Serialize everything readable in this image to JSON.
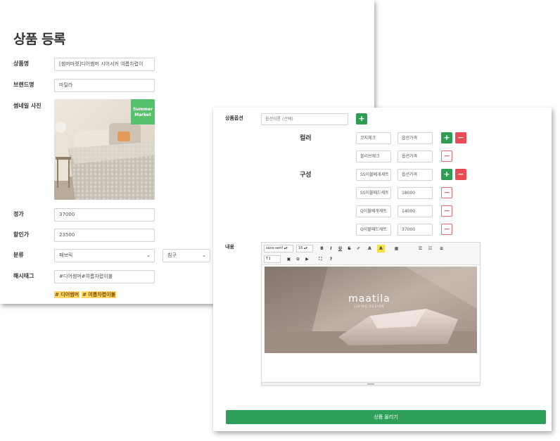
{
  "page": {
    "title": "상품 등록"
  },
  "form": {
    "name_label": "상품명",
    "name_value": "[썸머마켓]디어썸머 시어서커 여름차렵이",
    "brand_label": "브랜드명",
    "brand_value": "마틸라",
    "thumbnail_label": "썸네일 사진",
    "thumbnail_badge_line1": "Summer",
    "thumbnail_badge_line2": "Market",
    "price_label": "정가",
    "price_value": "37000",
    "sale_label": "할인가",
    "sale_value": "23500",
    "category_label": "분류",
    "category_value": "패브릭",
    "subcategory_value": "침구",
    "hashtag_label": "해시태그",
    "hashtag_value": "#디어썸머#여름차렵이불",
    "hashtag_chips": [
      "# 디어썸머",
      "# 여름차렵이불"
    ]
  },
  "options": {
    "label": "상품옵션",
    "name_placeholder": "옵션이름 (선택)",
    "add_symbol": "+",
    "remove_symbol": "−",
    "groups": [
      {
        "title": "컬러",
        "rows": [
          {
            "name": "코지체크",
            "price": "옵션가격"
          },
          {
            "name": "블리브체크",
            "price": "옵션가격"
          }
        ]
      },
      {
        "title": "구성",
        "rows": [
          {
            "name": "SS이불베개세트",
            "price": "옵션가격"
          },
          {
            "name": "SS이불패드세트",
            "price": "18000"
          },
          {
            "name": "Q이불베개세트",
            "price": "14000"
          },
          {
            "name": "Q이불패드세트",
            "price": "37000"
          }
        ]
      }
    ]
  },
  "content": {
    "label": "내용",
    "toolbar": {
      "font": "sans-serif",
      "size": "16",
      "bold": "B",
      "italic": "I",
      "underline": "U",
      "strike": "S",
      "eraser": "✐",
      "font_color": "A",
      "highlight": "A",
      "table": "▦",
      "ul": "☰",
      "ol": "☷",
      "align": "≡",
      "height": "T↕",
      "image": "▣",
      "link": "⊝",
      "video": "▶",
      "fullscreen": "⛶",
      "help": "?"
    },
    "image_brand": "maatila",
    "image_subtitle": "LIVING DESIGN"
  },
  "submit_label": "상품 올리기",
  "colors": {
    "green": "#2f9e55",
    "red": "#ea4a52",
    "tag_bg": "#ffd76a",
    "badge": "#55c16a"
  }
}
